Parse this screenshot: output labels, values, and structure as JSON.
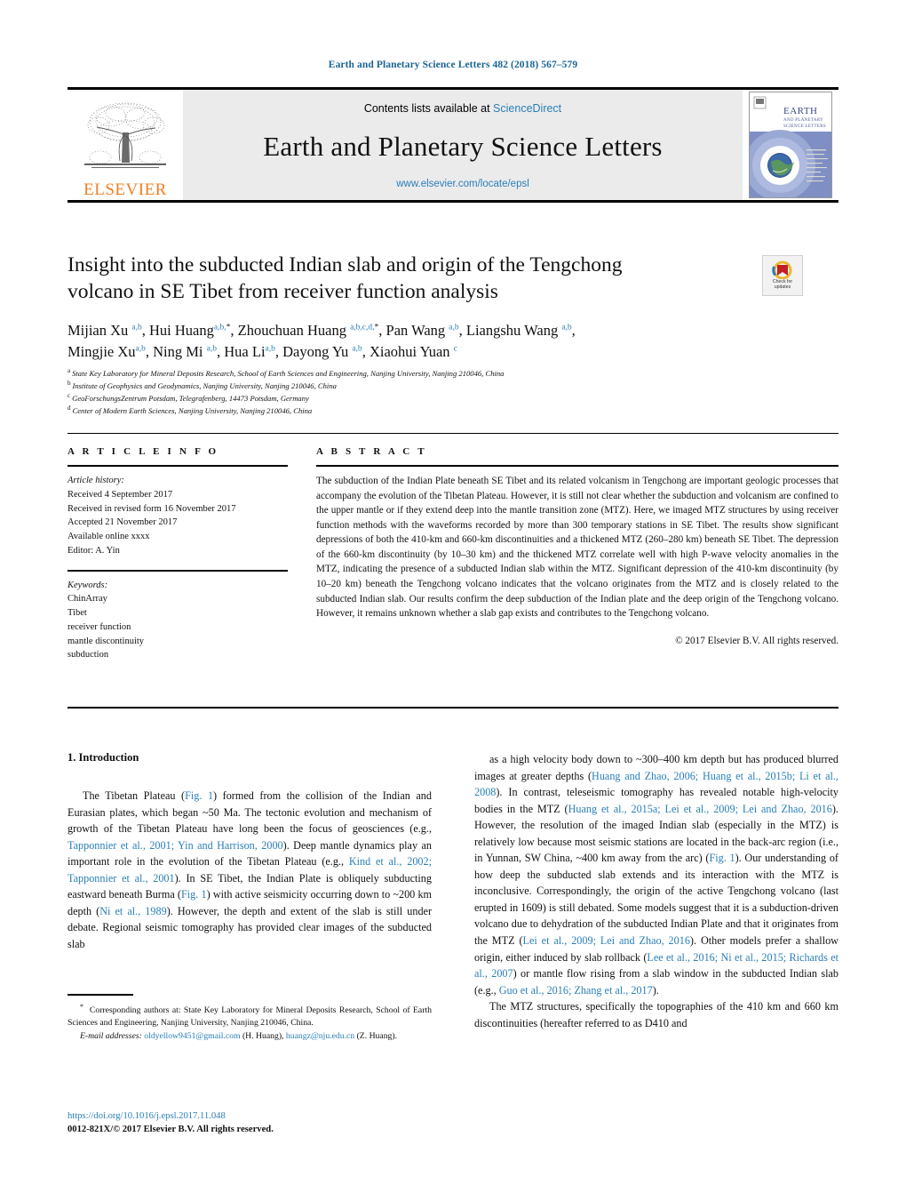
{
  "running_head": "Earth and Planetary Science Letters 482 (2018) 567–579",
  "masthead": {
    "contents_prefix": "Contents lists available at ",
    "sciencedirect": "ScienceDirect",
    "journal_title": "Earth and Planetary Science Letters",
    "journal_url": "www.elsevier.com/locate/epsl",
    "publisher": "ELSEVIER",
    "cover_title_line1": "EARTH",
    "cover_title_line2": "AND PLANETARY",
    "cover_title_line3": "SCIENCE LETTERS"
  },
  "title": {
    "line1": "Insight into the subducted Indian slab and origin of the Tengchong",
    "line2": "volcano in SE Tibet from receiver function analysis"
  },
  "crossmark": {
    "label_line1": "Check for",
    "label_line2": "updates"
  },
  "authors_html": "Mijian Xu <sup>a,b</sup>, Hui Huang<sup>a,b,</sup><sup class=\"ast\">*</sup>, Zhouchuan Huang <sup>a,b,c,d,</sup><sup class=\"ast\">*</sup>, Pan Wang <sup>a,b</sup>, Liangshu Wang <sup>a,b</sup>,<br>Mingjie Xu<sup>a,b</sup>, Ning Mi <sup>a,b</sup>, Hua Li<sup>a,b</sup>, Dayong Yu <sup>a,b</sup>, Xiaohui Yuan <sup>c</sup>",
  "affiliations": [
    {
      "marker": "a",
      "text": "State Key Laboratory for Mineral Deposits Research, School of Earth Sciences and Engineering, Nanjing University, Nanjing 210046, China"
    },
    {
      "marker": "b",
      "text": "Institute of Geophysics and Geodynamics, Nanjing University, Nanjing 210046, China"
    },
    {
      "marker": "c",
      "text": "GeoForschungsZentrum Potsdam, Telegrafenberg, 14473 Potsdam, Germany"
    },
    {
      "marker": "d",
      "text": "Center of Modern Earth Sciences, Nanjing University, Nanjing 210046, China"
    }
  ],
  "article_info": {
    "heading": "A R T I C L E   I N F O",
    "history_label": "Article history:",
    "history": [
      "Received 4 September 2017",
      "Received in revised form 16 November 2017",
      "Accepted 21 November 2017",
      "Available online xxxx",
      "Editor: A. Yin"
    ],
    "keywords_label": "Keywords:",
    "keywords": [
      "ChinArray",
      "Tibet",
      "receiver function",
      "mantle discontinuity",
      "subduction"
    ]
  },
  "abstract": {
    "heading": "A B S T R A C T",
    "text": "The subduction of the Indian Plate beneath SE Tibet and its related volcanism in Tengchong are important geologic processes that accompany the evolution of the Tibetan Plateau. However, it is still not clear whether the subduction and volcanism are confined to the upper mantle or if they extend deep into the mantle transition zone (MTZ). Here, we imaged MTZ structures by using receiver function methods with the waveforms recorded by more than 300 temporary stations in SE Tibet. The results show significant depressions of both the 410-km and 660-km discontinuities and a thickened MTZ (260–280 km) beneath SE Tibet. The depression of the 660-km discontinuity (by 10–30 km) and the thickened MTZ correlate well with high P-wave velocity anomalies in the MTZ, indicating the presence of a subducted Indian slab within the MTZ. Significant depression of the 410-km discontinuity (by 10–20 km) beneath the Tengchong volcano indicates that the volcano originates from the MTZ and is closely related to the subducted Indian slab. Our results confirm the deep subduction of the Indian plate and the deep origin of the Tengchong volcano. However, it remains unknown whether a slab gap exists and contributes to the Tengchong volcano.",
    "copyright": "© 2017 Elsevier B.V. All rights reserved."
  },
  "body": {
    "section_heading": "1. Introduction",
    "left_paragraph_html": "The Tibetan Plateau (<span class=\"ref\">Fig. 1</span>) formed from the collision of the Indian and Eurasian plates, which began ~50 Ma. The tectonic evolution and mechanism of growth of the Tibetan Plateau have long been the focus of geosciences (e.g., <span class=\"ref\">Tapponnier et al., 2001; Yin and Harrison, 2000</span>). Deep mantle dynamics play an important role in the evolution of the Tibetan Plateau (e.g., <span class=\"ref\">Kind et al., 2002; Tapponnier et al., 2001</span>). In SE Tibet, the Indian Plate is obliquely subducting eastward beneath Burma (<span class=\"ref\">Fig. 1</span>) with active seismicity occurring down to ~200 km depth (<span class=\"ref\">Ni et al., 1989</span>). However, the depth and extent of the slab is still under debate. Regional seismic tomography has provided clear images of the subducted slab",
    "right_paragraph1_html": "as a high velocity body down to ~300–400 km depth but has produced blurred images at greater depths (<span class=\"ref\">Huang and Zhao, 2006; Huang et al., 2015b; Li et al., 2008</span>). In contrast, teleseismic tomography has revealed notable high-velocity bodies in the MTZ (<span class=\"ref\">Huang et al., 2015a; Lei et al., 2009; Lei and Zhao, 2016</span>). However, the resolution of the imaged Indian slab (especially in the MTZ) is relatively low because most seismic stations are located in the back-arc region (i.e., in Yunnan, SW China, ~400 km away from the arc) (<span class=\"ref\">Fig. 1</span>). Our understanding of how deep the subducted slab extends and its interaction with the MTZ is inconclusive. Correspondingly, the origin of the active Tengchong volcano (last erupted in 1609) is still debated. Some models suggest that it is a subduction-driven volcano due to dehydration of the subducted Indian Plate and that it originates from the MTZ (<span class=\"ref\">Lei et al., 2009; Lei and Zhao, 2016</span>). Other models prefer a shallow origin, either induced by slab rollback (<span class=\"ref\">Lee et al., 2016; Ni et al., 2015; Richards et al., 2007</span>) or mantle flow rising from a slab window in the subducted Indian slab (e.g., <span class=\"ref\">Guo et al., 2016; Zhang et al., 2017</span>).",
    "right_paragraph2_html": "The MTZ structures, specifically the topographies of the 410 km and 660 km discontinuities (hereafter referred to as D410 and"
  },
  "footnote": {
    "correspondence_html": "<sup>*</sup>&nbsp; Corresponding authors at: State Key Laboratory for Mineral Deposits Research, School of Earth Sciences and Engineering, Nanjing University, Nanjing 210046, China.",
    "email_html": "<span class=\"it\">E-mail addresses:</span> <span class=\"ref\">oldyellow9451@gmail.com</span> (H. Huang), <span class=\"ref\">huangz@nju.edu.cn</span> (Z. Huang)."
  },
  "doi": {
    "url": "https://doi.org/10.1016/j.epsl.2017.11.048",
    "issn_line": "0012-821X/© 2017 Elsevier B.V. All rights reserved."
  },
  "colors": {
    "link_blue": "#2a7fb8",
    "elsevier_orange": "#f08020",
    "band_gray": "#ebebeb"
  }
}
